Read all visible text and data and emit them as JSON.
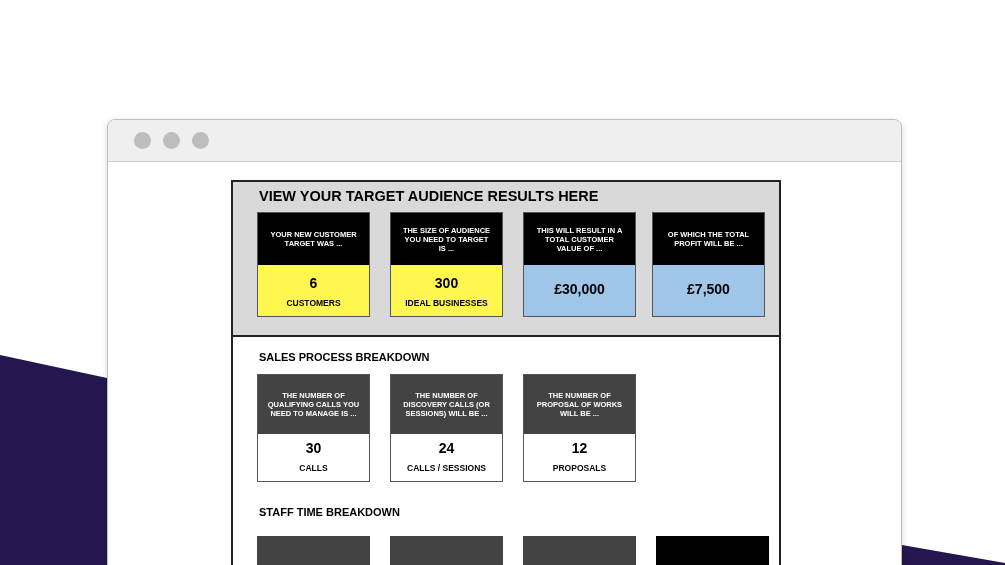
{
  "results": {
    "title": "VIEW YOUR TARGET AUDIENCE RESULTS HERE",
    "cards": [
      {
        "header": "YOUR NEW CUSTOMER TARGET WAS ...",
        "value": "6",
        "unit": "CUSTOMERS",
        "color": "#fff650"
      },
      {
        "header": "THE SIZE OF AUDIENCE YOU NEED TO TARGET IS ...",
        "value": "300",
        "unit": "IDEAL BUSINESSES",
        "color": "#fff650"
      },
      {
        "header": "THIS WILL RESULT IN A TOTAL CUSTOMER VALUE OF ...",
        "value": "£30,000",
        "color": "#9fc5e8"
      },
      {
        "header": "OF WHICH THE TOTAL PROFIT WILL BE ...",
        "value": "£7,500",
        "color": "#9fc5e8"
      }
    ]
  },
  "sales": {
    "title": "SALES PROCESS BREAKDOWN",
    "cards": [
      {
        "header": "THE NUMBER OF QUALIFYING CALLS YOU NEED TO MANAGE IS ...",
        "value": "30",
        "unit": "CALLS"
      },
      {
        "header": "THE NUMBER OF DISCOVERY CALLS (OR SESSIONS) WILL BE ...",
        "value": "24",
        "unit": "CALLS / SESSIONS"
      },
      {
        "header": "THE NUMBER OF PROPOSAL OF WORKS WILL BE ...",
        "value": "12",
        "unit": "PROPOSALS"
      }
    ]
  },
  "staff": {
    "title": "STAFF TIME BREAKDOWN",
    "cards": [
      {
        "color": "#434343"
      },
      {
        "color": "#434343"
      },
      {
        "color": "#434343"
      },
      {
        "color": "#000000"
      }
    ]
  }
}
